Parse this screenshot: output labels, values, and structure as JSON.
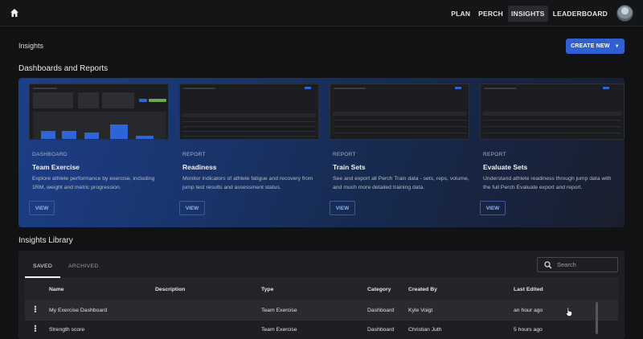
{
  "nav": {
    "items": [
      "PLAN",
      "PERCH",
      "INSIGHTS",
      "LEADERBOARD"
    ],
    "active": "INSIGHTS"
  },
  "header": {
    "title": "Insights",
    "create_label": "CREATE NEW"
  },
  "dashboards": {
    "title": "Dashboards and Reports",
    "cards": [
      {
        "type": "DASHBOARD",
        "name": "Team Exercise",
        "description": "Explore athlete performance by exercise, including 1RM, weight and metric progression.",
        "button": "VIEW"
      },
      {
        "type": "REPORT",
        "name": "Readiness",
        "description": "Monitor indicators of athlete fatigue and recovery from jump test results and assessment status.",
        "button": "VIEW"
      },
      {
        "type": "REPORT",
        "name": "Train Sets",
        "description": "See and export all Perch Train data - sets, reps, volume, and much more detailed training data.",
        "button": "VIEW"
      },
      {
        "type": "REPORT",
        "name": "Evaluate Sets",
        "description": "Understand athlete readiness through jump data with the full Perch Evaluate export and report.",
        "button": "VIEW"
      }
    ]
  },
  "library": {
    "title": "Insights Library",
    "tabs": [
      "SAVED",
      "ARCHIVED"
    ],
    "search_placeholder": "Search",
    "columns": [
      "Name",
      "Description",
      "Type",
      "Category",
      "Created By",
      "Last Edited"
    ],
    "rows": [
      {
        "name": "My Exercise Dashboard",
        "description": "",
        "type": "Team Exercise",
        "category": "Dashboard",
        "created_by": "Kyle Voigt",
        "last_edited": "an hour ago"
      },
      {
        "name": "Strength score",
        "description": "",
        "type": "Team Exercise",
        "category": "Dashboard",
        "created_by": "Christian Juth",
        "last_edited": "5 hours ago"
      }
    ]
  },
  "colors": {
    "accent": "#2f5fd0",
    "background": "#111214"
  }
}
